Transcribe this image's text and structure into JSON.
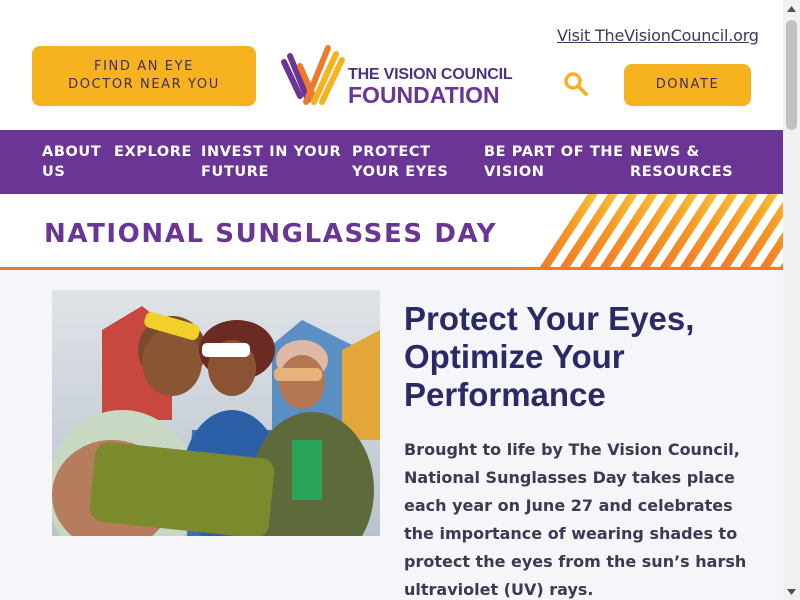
{
  "header": {
    "top_link": "Visit TheVisionCouncil.org",
    "find_button": "FIND AN EYE DOCTOR NEAR YOU",
    "find_button_line1": "FIND AN EYE",
    "find_button_line2": "DOCTOR NEAR YOU",
    "logo_line1": "THE VISION COUNCIL",
    "logo_line2": "FOUNDATION",
    "search_icon": "search-icon",
    "donate_button": "DONATE"
  },
  "nav": {
    "items": [
      {
        "line1": "ABOUT",
        "line2": "US"
      },
      {
        "line1": "EXPLORE",
        "line2": ""
      },
      {
        "line1": "INVEST IN YOUR",
        "line2": "FUTURE"
      },
      {
        "line1": "PROTECT",
        "line2": "YOUR EYES"
      },
      {
        "line1": "BE PART OF THE",
        "line2": "VISION"
      },
      {
        "line1": "NEWS &",
        "line2": "RESOURCES"
      }
    ]
  },
  "banner": {
    "title": "NATIONAL SUNGLASSES DAY"
  },
  "main": {
    "headline": "Protect Your Eyes, Optimize Your Performance",
    "body": "Brought to life by The Vision Council, National Sunglasses Day takes place each year on June 27 and celebrates the importance of wearing shades to protect the eyes from the sun’s harsh ultraviolet (UV) rays."
  },
  "colors": {
    "purple": "#6a3594",
    "yellow": "#f7b21f",
    "orange": "#f07a2b",
    "navy": "#2a2a66"
  }
}
